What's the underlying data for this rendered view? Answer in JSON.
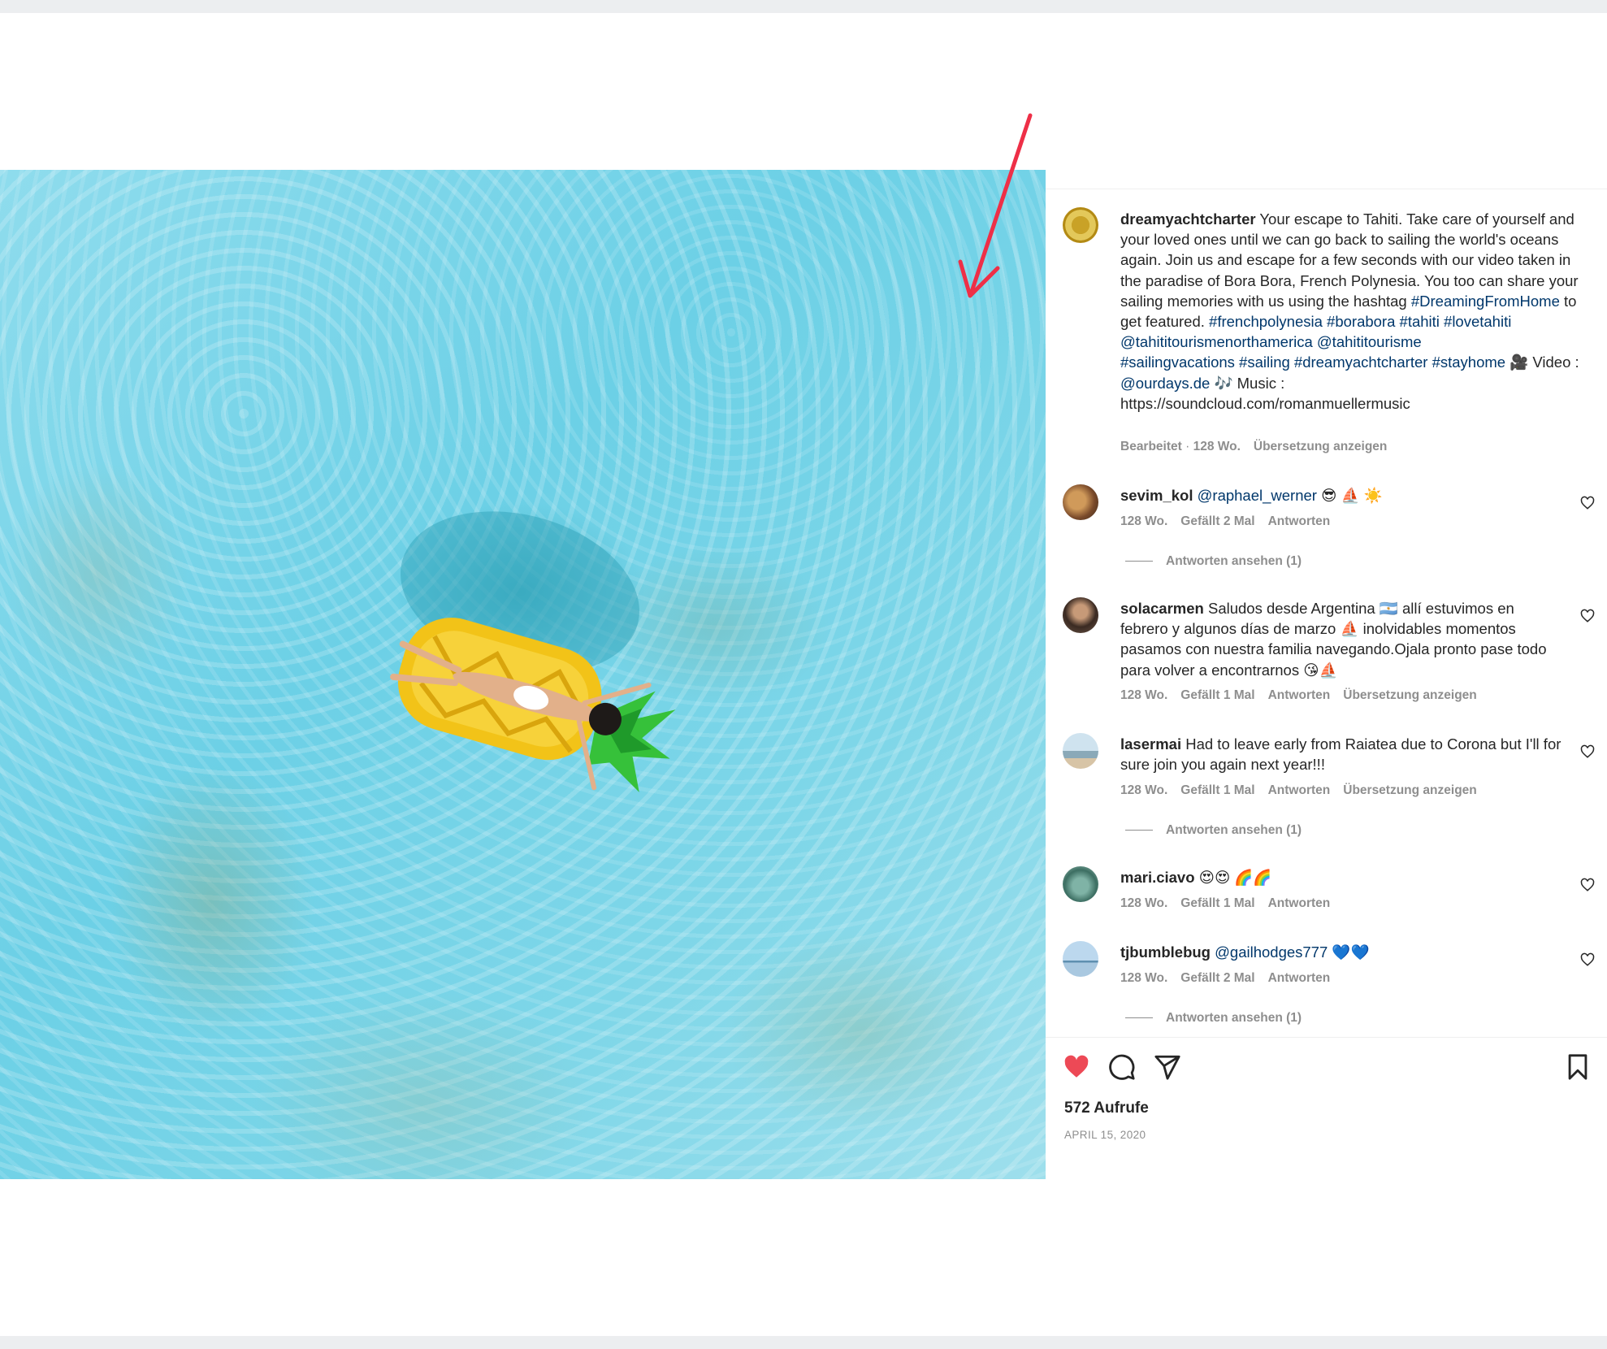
{
  "media": {
    "mute_icon": "speaker-muted-icon"
  },
  "annotation": {
    "arrow_color": "#ee2f47"
  },
  "post": {
    "author": "dreamyachtcharter",
    "caption_intro": " Your escape to Tahiti. Take care of yourself and your loved ones until we can go back to sailing the world's oceans again. Join us and escape for a few seconds with our video taken in the paradise of Bora Bora, French Polynesia. You too can share your sailing memories with us using the hashtag ",
    "hashtag_dreaming": "#DreamingFromHome",
    "caption_mid": " to get featured. ",
    "tags_line1": "#frenchpolynesia #borabora #tahiti #lovetahiti",
    "mentions_line": "@tahititourismenorthamerica @tahititourisme",
    "tags_line2": "#sailingvacations #sailing #dreamyachtcharter #stayhome",
    "camera_emoji": " 🎥",
    "video_label": " Video : ",
    "video_mention": "@ourdays.de",
    "music_label": " 🎶 Music : ",
    "music_url": "https://soundcloud.com/romanmuellermusic",
    "edited": "Bearbeitet",
    "dot": " · ",
    "age": "128 Wo.",
    "translate": "Übersetzung anzeigen"
  },
  "comments": [
    {
      "user": "sevim_kol",
      "mention": "@raphael_werner",
      "text": " 😎 ⛵ ☀️",
      "age": "128 Wo.",
      "likes": "Gefällt 2 Mal",
      "reply": "Antworten",
      "view_replies": "Antworten ansehen (1)"
    },
    {
      "user": "solacarmen",
      "text": " Saludos desde Argentina 🇦🇷 allí estuvimos en febrero y algunos días de marzo ⛵ inolvidables momentos pasamos con nuestra familia navegando.Ojala pronto pase todo para volver a encontrarnos 😘⛵",
      "age": "128 Wo.",
      "likes": "Gefällt 1 Mal",
      "reply": "Antworten",
      "translate": "Übersetzung anzeigen"
    },
    {
      "user": "lasermai",
      "text": " Had to leave early from Raiatea due to Corona but I'll for sure join you again next year!!!",
      "age": "128 Wo.",
      "likes": "Gefällt 1 Mal",
      "reply": "Antworten",
      "translate": "Übersetzung anzeigen",
      "view_replies": "Antworten ansehen (1)"
    },
    {
      "user": "mari.ciavo",
      "text": " 😍😍 🌈🌈",
      "age": "128 Wo.",
      "likes": "Gefällt 1 Mal",
      "reply": "Antworten"
    },
    {
      "user": "tjbumblebug",
      "mention": "@gailhodges777",
      "text": " 💙💙",
      "age": "128 Wo.",
      "likes": "Gefällt 2 Mal",
      "reply": "Antworten",
      "view_replies": "Antworten ansehen (1)"
    }
  ],
  "actions": {
    "like_icon": "heart-filled-icon",
    "comment_icon": "comment-bubble-icon",
    "share_icon": "paper-plane-icon",
    "save_icon": "bookmark-icon",
    "like_color": "#ed4956"
  },
  "stats": {
    "views": "572 Aufrufe",
    "date": "APRIL 15, 2020"
  }
}
